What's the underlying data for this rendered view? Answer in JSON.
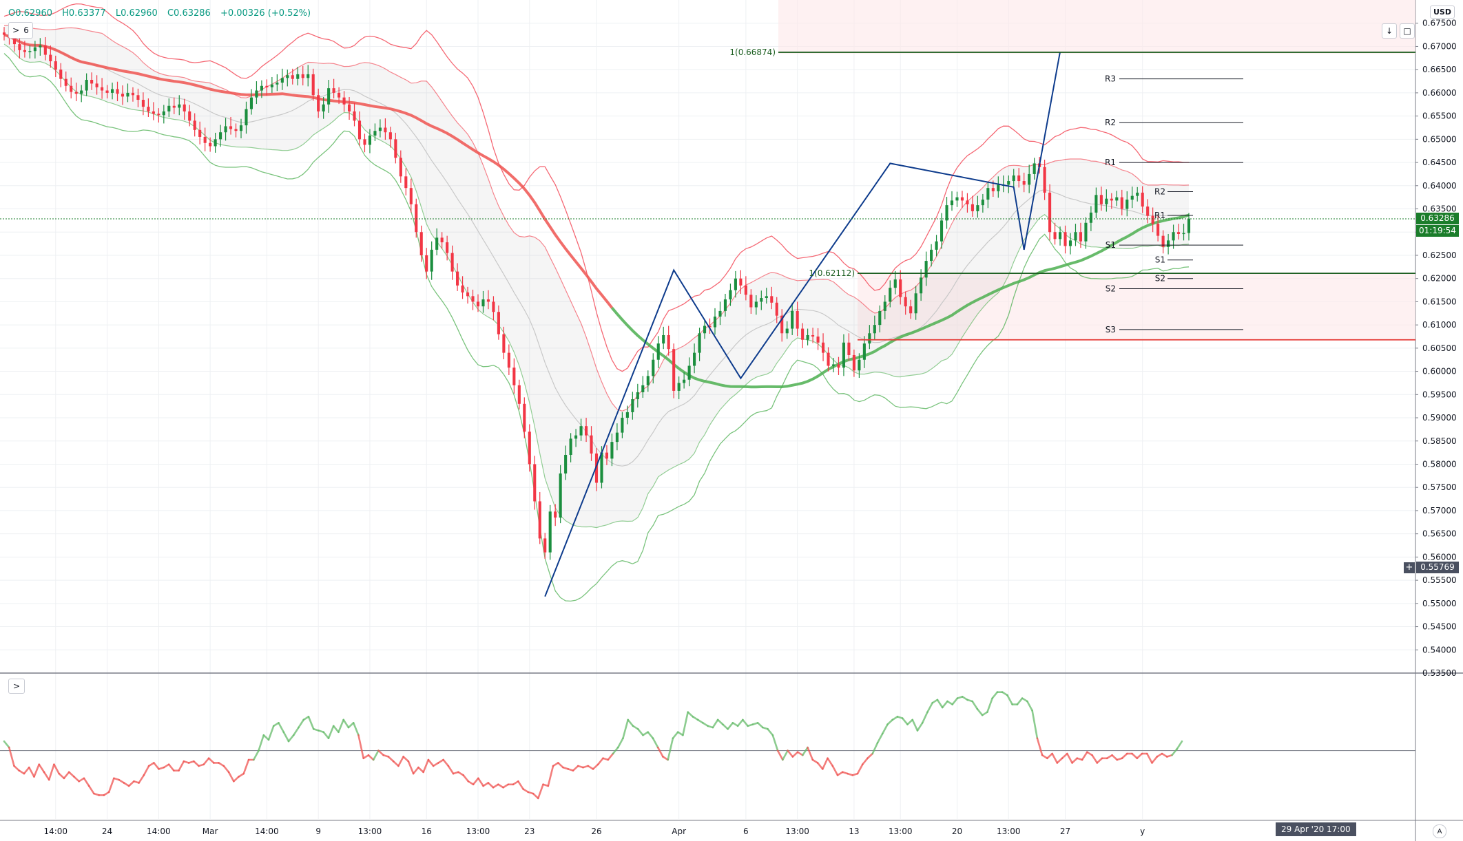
{
  "legend": {
    "open": "O0.62960",
    "high": "H0.63377",
    "low": "L0.62960",
    "close": "C0.63286",
    "change": "+0.00326 (+0.52%)",
    "indicator_count": "6"
  },
  "currency": "USD",
  "last_price": "0.63286",
  "countdown": "01:19:54",
  "cursor_price": "0.55769",
  "cursor_time": "29 Apr '20   17:00",
  "colors": {
    "bull": "#089981",
    "bear": "#f23645",
    "green_band": "#4caf50",
    "red_band": "#f23645",
    "pattern": "#0d3b8c",
    "level": "#1b5e20"
  },
  "chart_data": {
    "type": "candlestick",
    "y_range": [
      0.535,
      0.68
    ],
    "y_ticks": [
      "0.67500",
      "0.67000",
      "0.66500",
      "0.66000",
      "0.65500",
      "0.65000",
      "0.64500",
      "0.64000",
      "0.63500",
      "0.63000",
      "0.62500",
      "0.62000",
      "0.61500",
      "0.61000",
      "0.60500",
      "0.60000",
      "0.59500",
      "0.59000",
      "0.58500",
      "0.58000",
      "0.57500",
      "0.57000",
      "0.56500",
      "0.56000",
      "0.55500",
      "0.55000",
      "0.54500",
      "0.54000",
      "0.53500"
    ],
    "x_ticks": [
      {
        "label": "14:00",
        "i": 10
      },
      {
        "label": "24",
        "i": 20
      },
      {
        "label": "14:00",
        "i": 30
      },
      {
        "label": "Mar",
        "i": 40
      },
      {
        "label": "14:00",
        "i": 51
      },
      {
        "label": "9",
        "i": 61
      },
      {
        "label": "13:00",
        "i": 71
      },
      {
        "label": "16",
        "i": 82
      },
      {
        "label": "13:00",
        "i": 92
      },
      {
        "label": "23",
        "i": 102
      },
      {
        "label": "26",
        "i": 115
      },
      {
        "label": "Apr",
        "i": 131
      },
      {
        "label": "6",
        "i": 144
      },
      {
        "label": "13:00",
        "i": 154
      },
      {
        "label": "13",
        "i": 165
      },
      {
        "label": "13:00",
        "i": 174
      },
      {
        "label": "20",
        "i": 185
      },
      {
        "label": "13:00",
        "i": 195
      },
      {
        "label": "27",
        "i": 206
      },
      {
        "label": "y",
        "i": 221
      }
    ],
    "closes": [
      0.6725,
      0.6718,
      0.6705,
      0.6692,
      0.6688,
      0.669,
      0.6698,
      0.6702,
      0.6682,
      0.6668,
      0.665,
      0.663,
      0.6615,
      0.6602,
      0.6598,
      0.6605,
      0.6628,
      0.662,
      0.6612,
      0.6605,
      0.66,
      0.6608,
      0.6598,
      0.6592,
      0.66,
      0.6595,
      0.6585,
      0.657,
      0.656,
      0.6555,
      0.6552,
      0.656,
      0.6572,
      0.6568,
      0.6575,
      0.656,
      0.654,
      0.652,
      0.6505,
      0.6492,
      0.6485,
      0.65,
      0.6515,
      0.6528,
      0.6522,
      0.6518,
      0.653,
      0.6565,
      0.659,
      0.6605,
      0.6615,
      0.6612,
      0.6618,
      0.6622,
      0.6632,
      0.6638,
      0.663,
      0.664,
      0.6632,
      0.664,
      0.6595,
      0.656,
      0.6575,
      0.661,
      0.66,
      0.659,
      0.6575,
      0.656,
      0.654,
      0.65,
      0.6488,
      0.6508,
      0.6518,
      0.6525,
      0.6515,
      0.65,
      0.646,
      0.642,
      0.6395,
      0.636,
      0.63,
      0.625,
      0.6215,
      0.6262,
      0.6288,
      0.6278,
      0.6255,
      0.6215,
      0.6185,
      0.617,
      0.6162,
      0.615,
      0.614,
      0.6155,
      0.615,
      0.6128,
      0.608,
      0.604,
      0.6008,
      0.597,
      0.593,
      0.587,
      0.58,
      0.572,
      0.564,
      0.561,
      0.5698,
      0.5685,
      0.578,
      0.582,
      0.5855,
      0.5862,
      0.5882,
      0.5862,
      0.5823,
      0.576,
      0.5825,
      0.5812,
      0.5848,
      0.5868,
      0.59,
      0.5912,
      0.594,
      0.5955,
      0.597,
      0.599,
      0.6025,
      0.606,
      0.6078,
      0.6048,
      0.5958,
      0.5975,
      0.5982,
      0.6012,
      0.604,
      0.6082,
      0.6098,
      0.6095,
      0.6118,
      0.613,
      0.6155,
      0.6175,
      0.62,
      0.6185,
      0.6165,
      0.6138,
      0.615,
      0.6158,
      0.6162,
      0.6148,
      0.612,
      0.6082,
      0.6092,
      0.613,
      0.6092,
      0.6068,
      0.6078,
      0.6075,
      0.6062,
      0.604,
      0.6012,
      0.6015,
      0.6008,
      0.6062,
      0.6035,
      0.6002,
      0.6025,
      0.606,
      0.6082,
      0.61,
      0.613,
      0.615,
      0.618,
      0.6198,
      0.616,
      0.614,
      0.6125,
      0.6168,
      0.6202,
      0.6238,
      0.6262,
      0.628,
      0.6325,
      0.6358,
      0.6368,
      0.6375,
      0.6368,
      0.636,
      0.6345,
      0.6358,
      0.637,
      0.6395,
      0.6388,
      0.6402,
      0.6402,
      0.641,
      0.6422,
      0.641,
      0.6402,
      0.6425,
      0.6448,
      0.644,
      0.6385,
      0.63,
      0.6285,
      0.63,
      0.627,
      0.6282,
      0.63,
      0.628,
      0.632,
      0.6342,
      0.638,
      0.636,
      0.6372,
      0.6368,
      0.6375,
      0.635,
      0.637,
      0.6378,
      0.6385,
      0.6355,
      0.6335,
      0.6318,
      0.6292,
      0.6268,
      0.6282,
      0.63,
      0.6296,
      0.6298,
      0.6329
    ],
    "fib_levels": [
      {
        "label": "1(0.66874)",
        "value": 0.66874
      },
      {
        "label": "1(0.62112)",
        "value": 0.62112
      }
    ],
    "red_level": 0.6068,
    "pivots": [
      {
        "label": "R3",
        "value": 0.663
      },
      {
        "label": "R2",
        "value": 0.6536
      },
      {
        "label": "R1",
        "value": 0.645
      },
      {
        "label": "S1",
        "value": 0.6272
      },
      {
        "label": "S2",
        "value": 0.6178
      },
      {
        "label": "S3",
        "value": 0.609
      }
    ],
    "pivots_small": [
      {
        "label": "R2",
        "value": 0.6387
      },
      {
        "label": "R1",
        "value": 0.6336
      },
      {
        "label": "S1",
        "value": 0.624
      },
      {
        "label": "S2",
        "value": 0.62
      }
    ],
    "oscillator": {
      "midline": 50,
      "values": [
        56,
        52,
        40,
        37,
        35,
        39,
        33,
        41,
        36,
        31,
        41,
        35,
        32,
        36,
        33,
        30,
        32,
        27,
        22,
        21,
        21,
        23,
        32,
        31,
        29,
        27,
        30,
        29,
        34,
        40,
        42,
        38,
        39,
        41,
        37,
        37,
        43,
        42,
        43,
        40,
        41,
        45,
        42,
        42,
        40,
        36,
        30,
        33,
        35,
        44,
        44,
        50,
        60,
        57,
        66,
        68,
        62,
        56,
        60,
        65,
        70,
        72,
        64,
        63,
        62,
        58,
        66,
        62,
        70,
        65,
        68,
        60,
        45,
        47,
        44,
        50,
        47,
        46,
        43,
        40,
        46,
        43,
        35,
        39,
        36,
        44,
        40,
        42,
        44,
        40,
        35,
        36,
        34,
        30,
        28,
        32,
        27,
        29,
        26,
        28,
        26,
        28,
        28,
        30,
        25,
        23,
        22,
        19,
        28,
        27,
        40,
        42,
        39,
        38,
        37,
        40,
        39,
        40,
        38,
        41,
        45,
        44,
        48,
        52,
        58,
        70,
        66,
        64,
        60,
        62,
        58,
        52,
        46,
        44,
        58,
        62,
        60,
        75,
        72,
        70,
        68,
        66,
        65,
        70,
        67,
        64,
        68,
        66,
        70,
        66,
        67,
        68,
        65,
        64,
        60,
        50,
        44,
        50,
        46,
        49,
        47,
        52,
        44,
        42,
        38,
        45,
        40,
        34,
        36,
        35,
        34,
        35,
        41,
        45,
        48,
        55,
        61,
        67,
        70,
        72,
        71,
        67,
        70,
        63,
        68,
        75,
        81,
        83,
        78,
        82,
        80,
        84,
        85,
        83,
        82,
        77,
        73,
        75,
        84,
        88,
        88,
        86,
        80,
        80,
        84,
        82,
        76,
        58,
        47,
        45,
        48,
        42,
        45,
        48,
        42,
        45,
        44,
        49,
        47,
        42,
        45,
        45,
        47,
        44,
        45,
        48,
        48,
        45,
        48,
        48,
        42,
        46,
        48,
        46,
        47,
        51,
        56
      ]
    }
  }
}
